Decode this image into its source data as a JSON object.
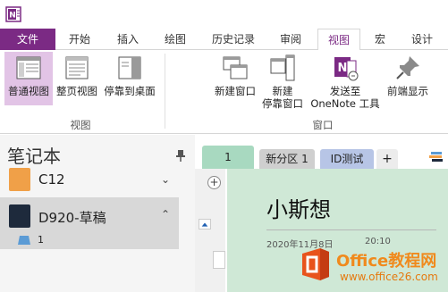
{
  "app": {
    "logo": "onenote-logo-icon"
  },
  "tabs": [
    {
      "label": "文件"
    },
    {
      "label": "开始"
    },
    {
      "label": "插入"
    },
    {
      "label": "绘图"
    },
    {
      "label": "历史记录"
    },
    {
      "label": "审阅"
    },
    {
      "label": "视图"
    },
    {
      "label": "宏"
    },
    {
      "label": "设计"
    }
  ],
  "active_tab": "视图",
  "ribbon": {
    "view_group": {
      "label": "视图",
      "buttons": [
        {
          "label": "普通视图",
          "icon": "normal-view-icon",
          "selected": true
        },
        {
          "label": "整页视图",
          "icon": "full-page-view-icon"
        },
        {
          "label": "停靠到桌面",
          "icon": "dock-to-desktop-icon"
        }
      ]
    },
    "window_group": {
      "label": "窗口",
      "buttons": [
        {
          "label": "新建窗口",
          "icon": "new-window-icon"
        },
        {
          "label_line1": "新建",
          "label_line2": "停靠窗口",
          "icon": "new-docked-window-icon"
        },
        {
          "label_line1": "发送至",
          "label_line2": "OneNote 工具",
          "icon": "send-to-onenote-icon"
        },
        {
          "label": "前端显示",
          "icon": "always-on-top-icon"
        }
      ]
    }
  },
  "notebook_pane": {
    "header": "笔记本",
    "notebooks": [
      {
        "name": "C12",
        "color": "#f0a048",
        "expanded": false
      },
      {
        "name": "D920-草稿",
        "color": "#1e2a3c",
        "expanded": true
      }
    ],
    "section": "1"
  },
  "section_tabs": [
    {
      "label": "1",
      "color": "#a8d9c0"
    },
    {
      "label": "新分区 1",
      "color": "#cfcfcf"
    },
    {
      "label": "ID测试",
      "color": "#b7c5e6"
    },
    {
      "label": "+"
    }
  ],
  "page": {
    "add_button": "+",
    "title": "小斯想",
    "date": "2020年11月8日",
    "time": "20:10",
    "background": "#cfe8d6"
  },
  "watermark": {
    "line1": "Office教程网",
    "line2": "www.office26.com"
  }
}
